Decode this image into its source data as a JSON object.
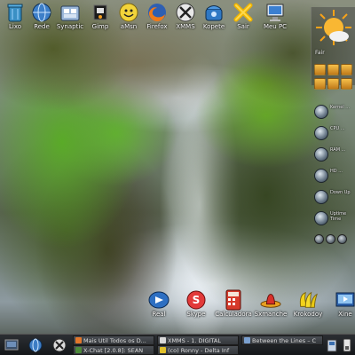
{
  "desktop": {
    "top_icons": [
      {
        "label": "Lixo",
        "icon": "trash-icon"
      },
      {
        "label": "Rede",
        "icon": "network-globe-icon"
      },
      {
        "label": "Synaptic",
        "icon": "package-manager-icon"
      },
      {
        "label": "Gimp",
        "icon": "gimp-icon"
      },
      {
        "label": "aMsn",
        "icon": "amsn-icon"
      },
      {
        "label": "Firefox",
        "icon": "firefox-icon"
      },
      {
        "label": "XMMS",
        "icon": "xmms-icon"
      },
      {
        "label": "Kopete",
        "icon": "phone-icon"
      },
      {
        "label": "Sair",
        "icon": "exit-x-icon"
      },
      {
        "label": "Meu PC",
        "icon": "monitor-icon"
      }
    ],
    "weather": {
      "condition": "Fair",
      "icon": "sun-cloud-icon"
    },
    "monitor": [
      {
        "label": "Kernel ...",
        "icon": "kernel-gauge-icon"
      },
      {
        "label": "CPU ...",
        "icon": "cpu-gauge-icon"
      },
      {
        "label": "RAM ...",
        "icon": "ram-gauge-icon"
      },
      {
        "label": "HD ...",
        "icon": "disk-gauge-icon"
      },
      {
        "label": "Down Up",
        "icon": "network-gauge-icon"
      },
      {
        "label": "Uptime Time",
        "icon": "uptime-gauge-icon"
      }
    ],
    "dock": [
      {
        "label": "Real",
        "icon": "realplayer-icon"
      },
      {
        "label": "Skype",
        "icon": "skype-icon"
      },
      {
        "label": "Calculadora",
        "icon": "calculator-icon"
      },
      {
        "label": "Sxmanche",
        "icon": "sombrero-icon"
      },
      {
        "label": "Krokodoy",
        "icon": "bananas-icon"
      },
      {
        "label": "Xine",
        "icon": "xine-icon"
      }
    ]
  },
  "taskbar": {
    "launchers": [
      "menu-icon",
      "globe-icon",
      "settings-icon"
    ],
    "tasks": [
      "Mais Util Todos os D...",
      "XMMS - 1. DIGITAL",
      "Between the Lines – C",
      "X-Chat [2.0.8]: SEAN",
      "(co) Ronny - Delta Inf",
      ""
    ],
    "tray": [
      "tray-status-icon",
      "tray-volume-icon"
    ]
  },
  "colors": {
    "taskbar_bg": "#1f2226",
    "label_shadow": "#000000"
  }
}
